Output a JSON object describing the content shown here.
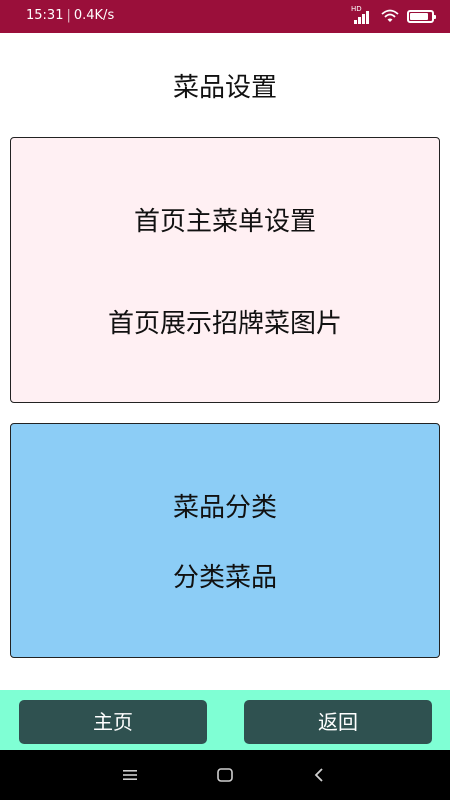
{
  "status_bar": {
    "time": "15:31",
    "speed": "0.4K/s",
    "signal_label": "HD",
    "battery_level": 0.85,
    "icons": [
      "signal-icon",
      "wifi-icon",
      "battery-icon"
    ]
  },
  "page": {
    "title": "菜品设置"
  },
  "cards": {
    "top": {
      "color": "#fff0f3",
      "items": [
        "首页主菜单设置",
        "首页展示招牌菜图片"
      ]
    },
    "bottom": {
      "color": "#8ccdf6",
      "items": [
        "菜品分类",
        "分类菜品"
      ]
    }
  },
  "bottom_bar": {
    "color": "#7fffd4",
    "button_color": "#2f5150",
    "home_label": "主页",
    "back_label": "返回"
  },
  "system_nav": {
    "icons": [
      "menu-icon",
      "home-square-icon",
      "back-chevron-icon"
    ]
  }
}
